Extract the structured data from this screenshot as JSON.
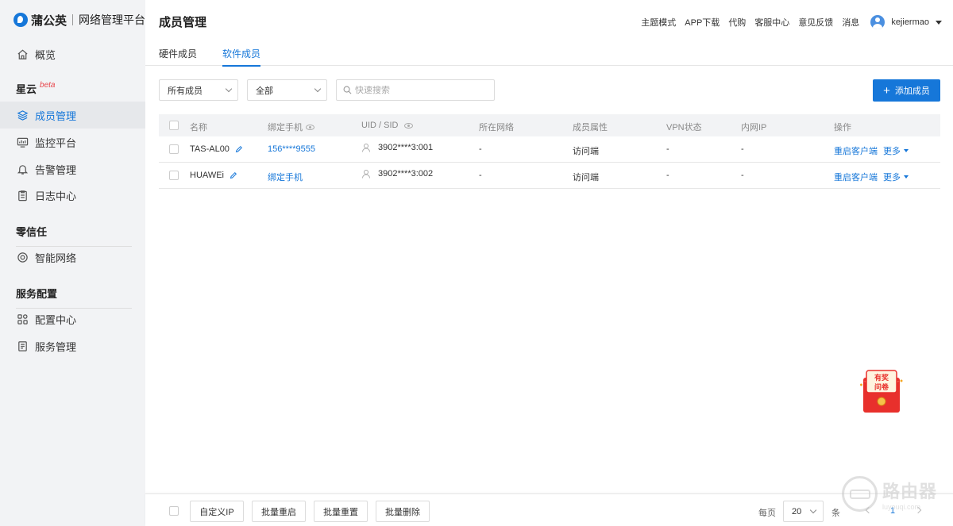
{
  "logo": {
    "brand": "蒲公英",
    "subtitle": "网络管理平台"
  },
  "sidebar": {
    "overview": "概览",
    "section_xingyun": "星云",
    "beta": "beta",
    "items": [
      {
        "label": "成员管理",
        "icon": "layers-icon"
      },
      {
        "label": "监控平台",
        "icon": "monitor-icon"
      },
      {
        "label": "告警管理",
        "icon": "bell-icon"
      },
      {
        "label": "日志中心",
        "icon": "clipboard-icon"
      }
    ],
    "section_zero_trust": "零信任",
    "smart_network": "智能网络",
    "section_service": "服务配置",
    "config_center": "配置中心",
    "service_mgmt": "服务管理"
  },
  "header": {
    "title": "成员管理",
    "links": [
      "主题模式",
      "APP下载",
      "代购",
      "客服中心",
      "意见反馈",
      "消息"
    ],
    "username": "kejiermao"
  },
  "tabs": {
    "hardware": "硬件成员",
    "software": "软件成员"
  },
  "filters": {
    "member_type": "所有成员",
    "status": "全部",
    "search_placeholder": "快速搜索",
    "add_button": "添加成员"
  },
  "table": {
    "headers": {
      "name": "名称",
      "phone": "绑定手机",
      "uid": "UID / SID",
      "network": "所在网络",
      "attr": "成员属性",
      "vpn": "VPN状态",
      "ip": "内网IP",
      "ops": "操作"
    },
    "rows": [
      {
        "name": "TAS-AL00",
        "phone": "156****9555",
        "uid": "3902****3:001",
        "network": "-",
        "attr": "访问端",
        "vpn": "-",
        "ip": "-",
        "restart": "重启客户端",
        "more": "更多"
      },
      {
        "name": "HUAWEi",
        "phone": "绑定手机",
        "uid": "3902****3:002",
        "network": "-",
        "attr": "访问端",
        "vpn": "-",
        "ip": "-",
        "restart": "重启客户端",
        "more": "更多"
      }
    ]
  },
  "survey": {
    "line1": "有奖",
    "line2": "问卷"
  },
  "bottom": {
    "custom_ip": "自定义IP",
    "batch_restart": "批量重启",
    "batch_reset": "批量重置",
    "batch_delete": "批量删除",
    "per_page": "每页",
    "page_size": "20",
    "unit": "条",
    "current_page": "1"
  },
  "watermark": {
    "cn": "路由器",
    "en": "luyouqi.com"
  },
  "colors": {
    "accent": "#1677d9",
    "sidebar_bg": "#f2f3f5"
  }
}
